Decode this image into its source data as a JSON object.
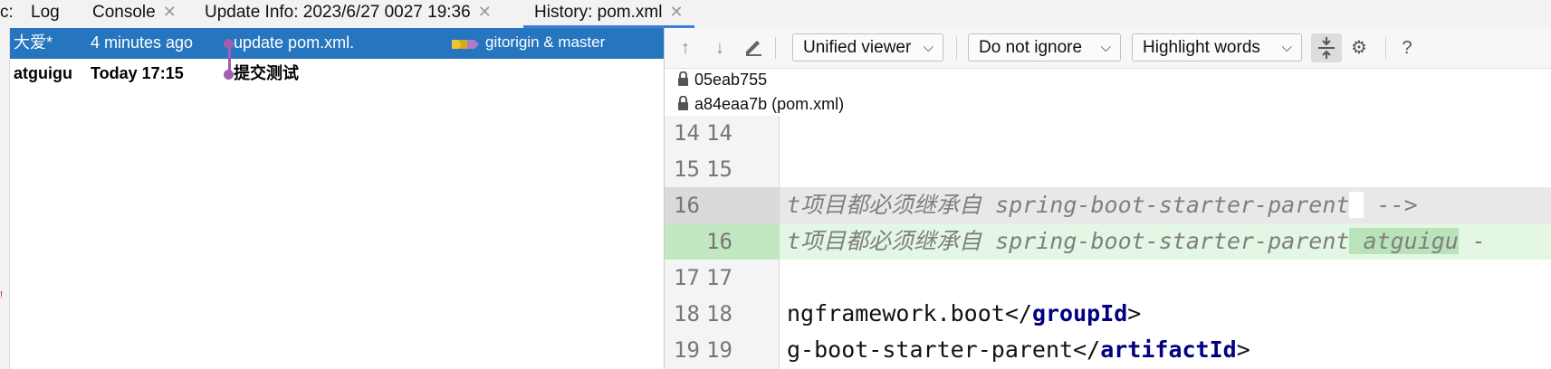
{
  "tabs": [
    {
      "label": "c:"
    },
    {
      "label": "Log"
    },
    {
      "label": "Console",
      "closable": true
    },
    {
      "label": "Update Info: 2023/6/27 0027 19:36",
      "closable": true
    },
    {
      "label": "History: pom.xml",
      "closable": true,
      "active": true
    }
  ],
  "close_glyph": "✕",
  "commits": [
    {
      "author": "大爱*",
      "date": "4 minutes ago",
      "message": "update pom.xml.",
      "refs": "gitorigin & master",
      "selected": true
    },
    {
      "author": "atguigu",
      "date": "Today 17:15",
      "message": "提交测试",
      "bold": true
    }
  ],
  "toolbar": {
    "viewer": "Unified viewer",
    "ignore": "Do not ignore",
    "highlight": "Highlight words",
    "help": "?"
  },
  "revisions": [
    "05eab755",
    "a84eaa7b (pom.xml)"
  ],
  "diff_lines": [
    {
      "left": "14",
      "right": "14",
      "text": ""
    },
    {
      "left": "15",
      "right": "15",
      "text": ""
    },
    {
      "left": "16",
      "right": "",
      "text_pre": "t项目都必须继承自 spring-boot-starter-parent",
      "text_post": " -->"
    },
    {
      "left": "",
      "right": "16",
      "text_pre": "t项目都必须继承自 spring-boot-starter-parent",
      "text_hl": " atguigu",
      "text_post": " -"
    },
    {
      "left": "17",
      "right": "17",
      "text": ""
    },
    {
      "left": "18",
      "right": "18",
      "text_pre": "ngframework.boot</",
      "tag": "groupId",
      "text_post": ">"
    },
    {
      "left": "19",
      "right": "19",
      "text_pre": "g-boot-starter-parent</",
      "tag": "artifactId",
      "text_post": ">"
    }
  ],
  "colors": {
    "selection": "#2675bf",
    "graph": "#a25fb0",
    "tab_accent": "#3f7bd8",
    "inserted": "#e4f6e4",
    "xml_tag": "#000080"
  }
}
